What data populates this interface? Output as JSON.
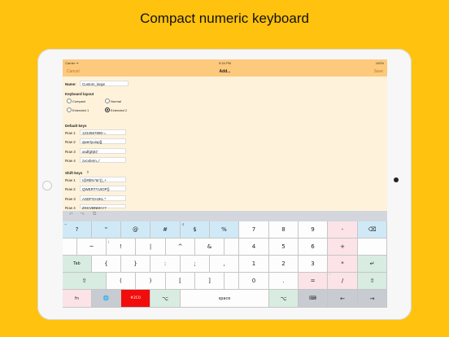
{
  "headline": "Compact numeric keyboard",
  "status": {
    "carrier": "Carrier ᯤ",
    "time": "9:34 PM",
    "battery": "100%"
  },
  "nav": {
    "cancel": "Cancel",
    "title": "Add...",
    "save": "Save"
  },
  "form": {
    "name_label": "Name:",
    "name_value": "Custom_large",
    "layout_label": "Keyboard layout",
    "layouts": [
      {
        "label": "Compact",
        "selected": false
      },
      {
        "label": "Normal",
        "selected": false
      },
      {
        "label": "Extended 1",
        "selected": false
      },
      {
        "label": "Extended 2",
        "selected": true
      }
    ],
    "default_label": "Default keys",
    "default_rows": [
      {
        "label": "Row 1",
        "value": "1234567890-="
      },
      {
        "label": "Row 2",
        "value": "qwertyuiop[]"
      },
      {
        "label": "Row 3",
        "value": "asdfghjkl;'"
      },
      {
        "label": "Row 4",
        "value": "zxcvbnm,./"
      }
    ],
    "shift_label": "Shift keys",
    "shift_icon": "⇧",
    "shift_rows": [
      {
        "label": "Row 1",
        "value": "!@#$%^&*()_+"
      },
      {
        "label": "Row 2",
        "value": "QWERTYUIOP{}"
      },
      {
        "label": "Row 3",
        "value": "ASDFGHJKL:\""
      },
      {
        "label": "Row 4",
        "value": "ZXCVBNM<>?"
      }
    ]
  },
  "toolbar": {
    "undo": "↶",
    "redo": "↷",
    "paste": "⧉"
  },
  "keys": {
    "r1": [
      {
        "l": "?",
        "s": "~"
      },
      {
        "l": "\""
      },
      {
        "l": "@"
      },
      {
        "l": "#"
      },
      {
        "l": "$",
        "s": "¢"
      },
      {
        "l": "%"
      },
      {
        "l": "7"
      },
      {
        "l": "8"
      },
      {
        "l": "9"
      },
      {
        "l": "-"
      },
      {
        "l": "⌫"
      }
    ],
    "r2": [
      {
        "l": "~"
      },
      {
        "l": "!",
        "s": "¡"
      },
      {
        "l": "|"
      },
      {
        "l": "^"
      },
      {
        "l": "&"
      },
      {
        "l": "4"
      },
      {
        "l": "5"
      },
      {
        "l": "6"
      },
      {
        "l": "+"
      }
    ],
    "r3": [
      {
        "l": "Tab"
      },
      {
        "l": "{"
      },
      {
        "l": "}"
      },
      {
        "l": ":"
      },
      {
        "l": ";"
      },
      {
        "l": ","
      },
      {
        "l": "1"
      },
      {
        "l": "2"
      },
      {
        "l": "3"
      },
      {
        "l": "*"
      },
      {
        "l": "↵"
      }
    ],
    "r4": [
      {
        "l": "⇧"
      },
      {
        "l": "("
      },
      {
        "l": ")"
      },
      {
        "l": "["
      },
      {
        "l": "]"
      },
      {
        "l": "0"
      },
      {
        "l": "."
      },
      {
        "l": "="
      },
      {
        "l": "/",
        "s": "`"
      },
      {
        "l": "⇧"
      }
    ],
    "r5": [
      {
        "l": "fn"
      },
      {
        "l": "🌐"
      },
      {
        "l": "#2C0"
      },
      {
        "l": "⌥"
      },
      {
        "l": "space"
      },
      {
        "l": "⌥"
      },
      {
        "l": "⌨"
      },
      {
        "l": "←"
      },
      {
        "l": "→"
      }
    ]
  }
}
